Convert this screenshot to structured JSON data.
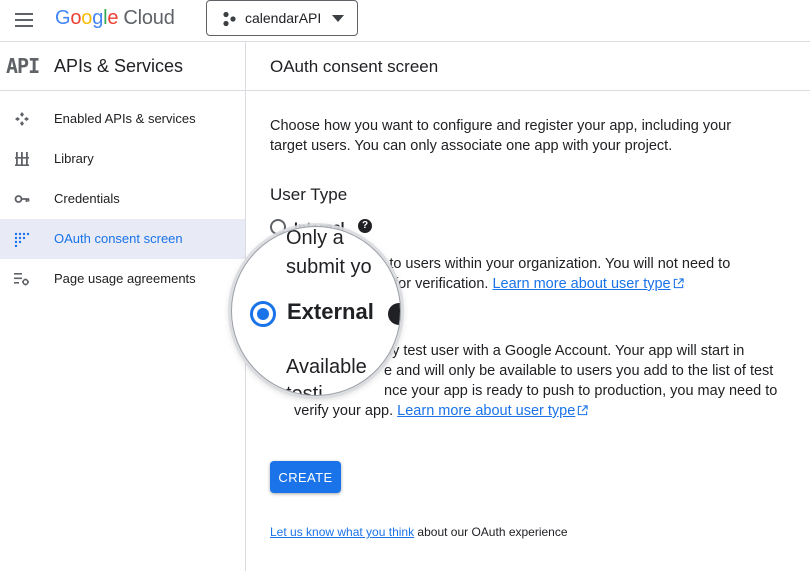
{
  "header": {
    "logo_letters": [
      "G",
      "o",
      "o",
      "g",
      "l",
      "e"
    ],
    "logo_product": "Cloud",
    "project_name": "calendarAPI"
  },
  "sidebar": {
    "api_logo": "API",
    "title": "APIs & Services",
    "items": [
      {
        "label": "Enabled APIs & services",
        "icon": "apis-diamond-icon",
        "active": false
      },
      {
        "label": "Library",
        "icon": "library-icon",
        "active": false
      },
      {
        "label": "Credentials",
        "icon": "key-icon",
        "active": false
      },
      {
        "label": "OAuth consent screen",
        "icon": "consent-dots-icon",
        "active": true
      },
      {
        "label": "Page usage agreements",
        "icon": "settings-list-icon",
        "active": false
      }
    ]
  },
  "main": {
    "page_title": "OAuth consent screen",
    "intro": "Choose how you want to configure and register your app, including your target users. You can only associate one app with your project.",
    "user_type_title": "User Type",
    "internal": {
      "label": "Internal",
      "help": "?",
      "description": "Only available to users within your organization. You will not need to submit your app for verification.",
      "visible_description": "le to users within your organization. You will not need to",
      "visible_description_line2": "pp for verification.",
      "link": "Learn more about user type"
    },
    "external": {
      "label": "External",
      "selected": true,
      "visible_description": "ny test user with a Google Account. Your app will start in",
      "visible_description_line2": "e and will only be available to users you add to the list of test",
      "visible_description_line3": "nce your app is ready to push to production, you may need to",
      "visible_description_line4": "verify your app.",
      "link": "Learn more about user type"
    },
    "create_label": "CREATE",
    "feedback_link": "Let us know what you think",
    "feedback_rest": " about our OAuth experience"
  },
  "magnifier": {
    "line1": "Only a",
    "line2": "submit yo",
    "selected_label": "External",
    "line3": "Available",
    "line4": "testi"
  },
  "colors": {
    "accent": "#1a73e8",
    "active_nav_bg": "#e8eaf6",
    "border": "#dadce0"
  }
}
